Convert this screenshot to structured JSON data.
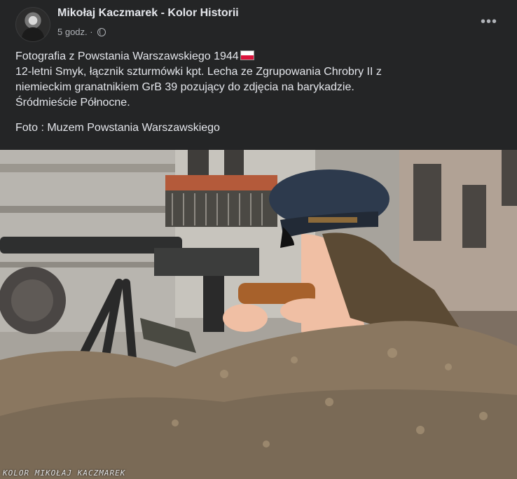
{
  "post": {
    "author": "Mikołaj Kaczmarek - Kolor Historii",
    "time": "5 godz.",
    "separator": " · ",
    "privacy_icon": "globe-icon",
    "more_icon": "more-options-icon",
    "more_label": "•••"
  },
  "content": {
    "line1": "Fotografia z Powstania Warszawskiego 1944",
    "line2": "12-letni Smyk, łącznik szturmówki kpt. Lecha ze Zgrupowania Chrobry II z",
    "line3": "niemieckim granatnikiem GrB 39 pozujący do zdjęcia na barykadzie.",
    "line4": "Śródmieście Północne.",
    "photo_credit": "Foto : Muzem Powstania Warszawskiego"
  },
  "photo": {
    "watermark": "KOLOR MIKOŁAJ KACZMAREK"
  }
}
